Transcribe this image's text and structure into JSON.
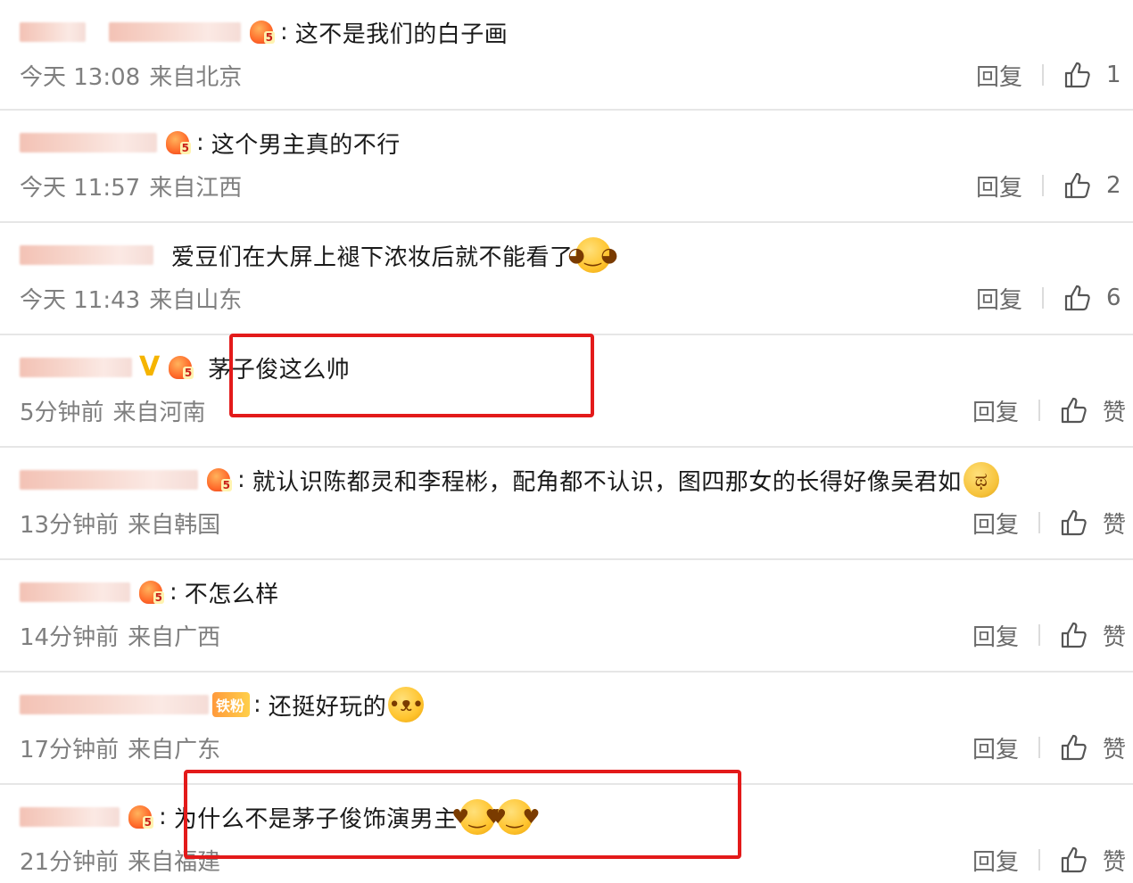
{
  "comments": [
    {
      "text": "这不是我们的白子画",
      "time": "今天 13:08",
      "location": "来自北京",
      "reply": "回复",
      "likes": "1",
      "emoji": ""
    },
    {
      "text": "这个男主真的不行",
      "time": "今天 11:57",
      "location": "来自江西",
      "reply": "回复",
      "likes": "2",
      "emoji": ""
    },
    {
      "text": "爱豆们在大屏上褪下浓妆后就不能看了",
      "time": "今天 11:43",
      "location": "来自山东",
      "reply": "回复",
      "likes": "6",
      "emoji": "laugh-cry-emoji"
    },
    {
      "text": "茅子俊这么帅",
      "time": "5分钟前",
      "location": "来自河南",
      "reply": "回复",
      "likes": "赞",
      "emoji": ""
    },
    {
      "text": "就认识陈都灵和李程彬，配角都不认识，图四那女的长得好像吴君如",
      "time": "13分钟前",
      "location": "来自韩国",
      "reply": "回复",
      "likes": "赞",
      "emoji": "crying-emoji"
    },
    {
      "text": "不怎么样",
      "time": "14分钟前",
      "location": "来自广西",
      "reply": "回复",
      "likes": "赞",
      "emoji": ""
    },
    {
      "text": "还挺好玩的",
      "time": "17分钟前",
      "location": "来自广东",
      "reply": "回复",
      "likes": "赞",
      "emoji": "doge-emoji"
    },
    {
      "text": "为什么不是茅子俊饰演男主",
      "time": "21分钟前",
      "location": "来自福建",
      "reply": "回复",
      "likes": "赞",
      "emoji": "heart-eyes-emoji"
    }
  ],
  "badges": {
    "fan_tag": "铁粉",
    "badge_number": "5",
    "vip_mark": "V"
  },
  "colors": {
    "highlight_box": "#e31a1a",
    "meta_text": "#7f7f7f",
    "badge_orange": "#ff6a2a",
    "vip_gold": "#f5b400"
  }
}
